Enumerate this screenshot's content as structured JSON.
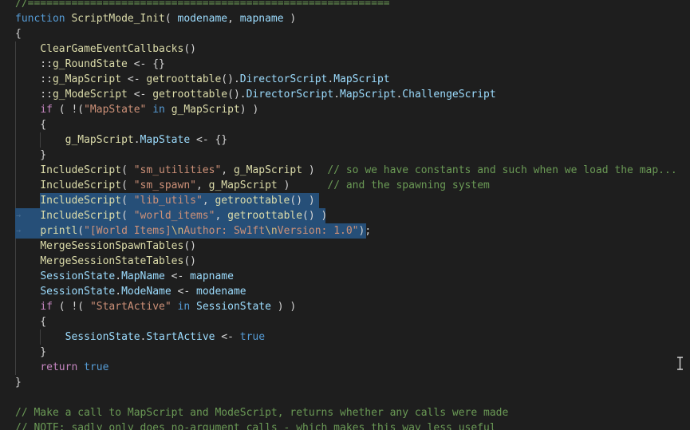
{
  "editor": {
    "colors": {
      "background": "#1e1e1e",
      "selection": "#264f78",
      "keyword": "#569cd6",
      "function": "#dcdcaa",
      "variable": "#9cdcfe",
      "string": "#ce9178",
      "comment": "#6a9955"
    },
    "lines": [
      [
        {
          "t": "//==========================================================",
          "c": "cm"
        }
      ],
      [
        {
          "t": "function",
          "c": "kw"
        },
        {
          "t": " "
        },
        {
          "t": "ScriptMode_Init",
          "c": "fn"
        },
        {
          "t": "( "
        },
        {
          "t": "modename",
          "c": "var"
        },
        {
          "t": ", "
        },
        {
          "t": "mapname",
          "c": "var"
        },
        {
          "t": " )"
        }
      ],
      [
        {
          "t": "{"
        }
      ],
      [
        {
          "t": "    "
        },
        {
          "t": "ClearGameEventCallbacks",
          "c": "fn"
        },
        {
          "t": "()"
        }
      ],
      [
        {
          "t": "    ::"
        },
        {
          "t": "g_RoundState",
          "c": "fn"
        },
        {
          "t": " <- {}"
        }
      ],
      [
        {
          "t": "    ::"
        },
        {
          "t": "g_MapScript",
          "c": "fn"
        },
        {
          "t": " <- "
        },
        {
          "t": "getroottable",
          "c": "fn"
        },
        {
          "t": "()."
        },
        {
          "t": "DirectorScript",
          "c": "var"
        },
        {
          "t": "."
        },
        {
          "t": "MapScript",
          "c": "var"
        }
      ],
      [
        {
          "t": "    ::"
        },
        {
          "t": "g_ModeScript",
          "c": "fn"
        },
        {
          "t": " <- "
        },
        {
          "t": "getroottable",
          "c": "fn"
        },
        {
          "t": "()."
        },
        {
          "t": "DirectorScript",
          "c": "var"
        },
        {
          "t": "."
        },
        {
          "t": "MapScript",
          "c": "var"
        },
        {
          "t": "."
        },
        {
          "t": "ChallengeScript",
          "c": "var"
        }
      ],
      [
        {
          "t": "    "
        },
        {
          "t": "if",
          "c": "kw2"
        },
        {
          "t": " ( !("
        },
        {
          "t": "\"MapState\"",
          "c": "str"
        },
        {
          "t": " "
        },
        {
          "t": "in",
          "c": "kw"
        },
        {
          "t": " "
        },
        {
          "t": "g_MapScript",
          "c": "fn"
        },
        {
          "t": ") )"
        }
      ],
      [
        {
          "t": "    {"
        }
      ],
      [
        {
          "t": "        "
        },
        {
          "t": "g_MapScript",
          "c": "fn"
        },
        {
          "t": "."
        },
        {
          "t": "MapState",
          "c": "var"
        },
        {
          "t": " <- {}"
        }
      ],
      [
        {
          "t": "    }"
        }
      ],
      [
        {
          "t": "    "
        },
        {
          "t": "IncludeScript",
          "c": "fn"
        },
        {
          "t": "( "
        },
        {
          "t": "\"sm_utilities\"",
          "c": "str"
        },
        {
          "t": ", "
        },
        {
          "t": "g_MapScript",
          "c": "fn"
        },
        {
          "t": " )  "
        },
        {
          "t": "// so we have constants and such when we load the map...",
          "c": "cm"
        }
      ],
      [
        {
          "t": "    "
        },
        {
          "t": "IncludeScript",
          "c": "fn"
        },
        {
          "t": "( "
        },
        {
          "t": "\"sm_spawn\"",
          "c": "str"
        },
        {
          "t": ", "
        },
        {
          "t": "g_MapScript",
          "c": "fn"
        },
        {
          "t": " )      "
        },
        {
          "t": "// and the spawning system",
          "c": "cm"
        }
      ],
      [
        {
          "t": "    "
        },
        {
          "t": "IncludeScript",
          "c": "fn"
        },
        {
          "t": "( "
        },
        {
          "t": "\"lib_utils\"",
          "c": "str"
        },
        {
          "t": ", "
        },
        {
          "t": "getroottable",
          "c": "fn"
        },
        {
          "t": "() )"
        }
      ],
      [
        {
          "t": "    "
        },
        {
          "t": "IncludeScript",
          "c": "fn"
        },
        {
          "t": "( "
        },
        {
          "t": "\"world_items\"",
          "c": "str"
        },
        {
          "t": ", "
        },
        {
          "t": "getroottable",
          "c": "fn"
        },
        {
          "t": "() )"
        }
      ],
      [
        {
          "t": "    "
        },
        {
          "t": "printl",
          "c": "fn"
        },
        {
          "t": "("
        },
        {
          "t": "\"[World Items]",
          "c": "str"
        },
        {
          "t": "\\n",
          "c": "esc"
        },
        {
          "t": "Author: Sw1ft",
          "c": "str"
        },
        {
          "t": "\\n",
          "c": "esc"
        },
        {
          "t": "Version: 1.0\"",
          "c": "str"
        },
        {
          "t": ");"
        }
      ],
      [
        {
          "t": "    "
        },
        {
          "t": "MergeSessionSpawnTables",
          "c": "fn"
        },
        {
          "t": "()"
        }
      ],
      [
        {
          "t": "    "
        },
        {
          "t": "MergeSessionStateTables",
          "c": "fn"
        },
        {
          "t": "()"
        }
      ],
      [
        {
          "t": "    "
        },
        {
          "t": "SessionState",
          "c": "var"
        },
        {
          "t": "."
        },
        {
          "t": "MapName",
          "c": "var"
        },
        {
          "t": " <- "
        },
        {
          "t": "mapname",
          "c": "var"
        }
      ],
      [
        {
          "t": "    "
        },
        {
          "t": "SessionState",
          "c": "var"
        },
        {
          "t": "."
        },
        {
          "t": "ModeName",
          "c": "var"
        },
        {
          "t": " <- "
        },
        {
          "t": "modename",
          "c": "var"
        }
      ],
      [
        {
          "t": "    "
        },
        {
          "t": "if",
          "c": "kw2"
        },
        {
          "t": " ( !( "
        },
        {
          "t": "\"StartActive\"",
          "c": "str"
        },
        {
          "t": " "
        },
        {
          "t": "in",
          "c": "kw"
        },
        {
          "t": " "
        },
        {
          "t": "SessionState",
          "c": "var"
        },
        {
          "t": " ) )"
        }
      ],
      [
        {
          "t": "    {"
        }
      ],
      [
        {
          "t": "        "
        },
        {
          "t": "SessionState",
          "c": "var"
        },
        {
          "t": "."
        },
        {
          "t": "StartActive",
          "c": "var"
        },
        {
          "t": " <- "
        },
        {
          "t": "true",
          "c": "kw"
        }
      ],
      [
        {
          "t": "    }"
        }
      ],
      [
        {
          "t": "    "
        },
        {
          "t": "return",
          "c": "kw2"
        },
        {
          "t": " "
        },
        {
          "t": "true",
          "c": "kw"
        }
      ],
      [
        {
          "t": "}"
        }
      ],
      [
        {
          "t": ""
        }
      ],
      [
        {
          "t": "// Make a call to MapScript and ModeScript, returns whether any calls were made",
          "c": "cm"
        }
      ],
      [
        {
          "t": "// NOTE: sadly only does no-argument calls - which makes this way less useful",
          "c": "cm"
        }
      ]
    ]
  }
}
